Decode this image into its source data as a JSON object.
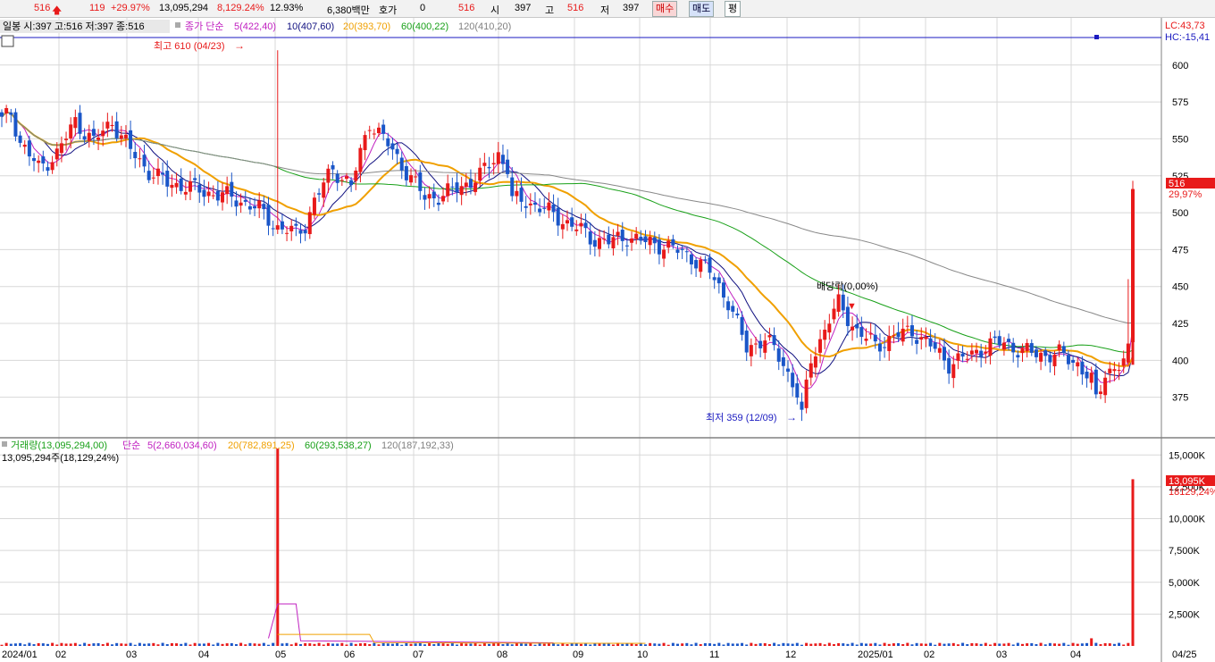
{
  "topbar": {
    "price": "516",
    "change": "119",
    "change_pct": "+29.97%",
    "volume": "13,095,294",
    "volume_ratio": "8,129.24%",
    "turnover_rate": "12.93%",
    "trade_value": "6,380백만",
    "quote_label": "호가",
    "quote_value": "0",
    "quote_price": "516",
    "open_label": "시",
    "open_value": "397",
    "high_label": "고",
    "high_value": "516",
    "low_label": "저",
    "low_value": "397",
    "buy_label": "매수",
    "sell_label": "매도",
    "avg_label": "평"
  },
  "price_legend": {
    "ohlc": "일봉 시:397 고:516 저:397 종:516",
    "ma_prefix": "종가 단순",
    "ma5": "5(422,40)",
    "ma10": "10(407,60)",
    "ma20": "20(393,70)",
    "ma60": "60(400,22)",
    "ma120": "120(410,20)"
  },
  "volume_legend": {
    "vol": "거래량(13,095,294,00)",
    "ma_prefix": "단순",
    "ma5": "5(2,660,034,60)",
    "ma20": "20(782,891,25)",
    "ma60": "60(293,538,27)",
    "ma120": "120(187,192,33)",
    "sub": "13,095,294주(18,129,24%)"
  },
  "right_labels": {
    "lc": "LC:43,73",
    "hc": "HC:-15,41",
    "last_price": "516",
    "last_pct": "29,97%",
    "last_vol": "13,095K",
    "last_vol_pct": "18129,24%"
  },
  "annotations": {
    "high": "최고 610 (04/23)",
    "low": "최저 359 (12/09)",
    "dividend": "배당락(0,00%)"
  },
  "colors": {
    "up": "#e81a1a",
    "down": "#1a56c8",
    "ma5": "#c020c0",
    "ma10": "#101080",
    "ma20": "#f0a000",
    "ma60": "#18a018",
    "ma120": "#888888",
    "grid": "#d8d8d8"
  },
  "chart_data": [
    {
      "type": "candlestick",
      "title": "",
      "x": [
        "2024/01",
        "02",
        "03",
        "04",
        "05",
        "06",
        "07",
        "08",
        "09",
        "10",
        "11",
        "12",
        "2025/01",
        "02",
        "03",
        "04",
        "04/25"
      ],
      "ylim": [
        350,
        615
      ],
      "y_ticks": [
        375,
        400,
        425,
        450,
        475,
        500,
        525,
        550,
        575,
        600
      ],
      "anchors": [
        [
          0,
          562
        ],
        [
          2,
          568
        ],
        [
          4,
          548
        ],
        [
          8,
          530
        ],
        [
          12,
          540
        ],
        [
          16,
          562
        ],
        [
          20,
          548
        ],
        [
          24,
          562
        ],
        [
          28,
          542
        ],
        [
          32,
          528
        ],
        [
          36,
          520
        ],
        [
          40,
          518
        ],
        [
          44,
          514
        ],
        [
          48,
          512
        ],
        [
          52,
          508
        ],
        [
          56,
          502
        ],
        [
          60,
          490
        ],
        [
          64,
          486
        ],
        [
          66,
          492
        ],
        [
          68,
          508
        ],
        [
          72,
          530
        ],
        [
          76,
          518
        ],
        [
          78,
          540
        ],
        [
          80,
          562
        ],
        [
          84,
          546
        ],
        [
          88,
          528
        ],
        [
          92,
          510
        ],
        [
          96,
          512
        ],
        [
          100,
          518
        ],
        [
          104,
          525
        ],
        [
          108,
          540
        ],
        [
          110,
          530
        ],
        [
          111,
          508
        ],
        [
          114,
          508
        ],
        [
          118,
          502
        ],
        [
          122,
          495
        ],
        [
          126,
          488
        ],
        [
          128,
          483
        ],
        [
          132,
          480
        ],
        [
          136,
          484
        ],
        [
          140,
          480
        ],
        [
          144,
          478
        ],
        [
          150,
          470
        ],
        [
          154,
          460
        ],
        [
          158,
          440
        ],
        [
          162,
          408
        ],
        [
          166,
          415
        ],
        [
          170,
          398
        ],
        [
          173,
          378
        ],
        [
          174,
          362
        ],
        [
          176,
          400
        ],
        [
          180,
          428
        ],
        [
          182,
          438
        ],
        [
          186,
          420
        ],
        [
          190,
          410
        ],
        [
          194,
          416
        ],
        [
          198,
          420
        ],
        [
          202,
          410
        ],
        [
          206,
          398
        ],
        [
          210,
          402
        ],
        [
          214,
          410
        ],
        [
          218,
          412
        ],
        [
          222,
          406
        ],
        [
          226,
          404
        ],
        [
          230,
          404
        ],
        [
          234,
          398
        ],
        [
          237,
          386
        ],
        [
          238,
          372
        ],
        [
          240,
          392
        ],
        [
          244,
          398
        ],
        [
          245,
          405
        ],
        [
          246,
          516
        ]
      ],
      "annotated_points": [
        {
          "label": "최고",
          "date": "04/23",
          "value": 610
        },
        {
          "label": "최저",
          "date": "12/09",
          "value": 359
        },
        {
          "label": "last",
          "date": "04/25",
          "open": 397,
          "high": 516,
          "low": 397,
          "close": 516
        }
      ],
      "moving_averages": [
        "MA5",
        "MA10",
        "MA20",
        "MA60",
        "MA120"
      ]
    },
    {
      "type": "bar",
      "title": "",
      "series_name": "거래량",
      "ylim": [
        0,
        16000
      ],
      "y_ticks": [
        "2,500K",
        "5,000K",
        "7,500K",
        "10,000K",
        "12,500K",
        "15,000K"
      ],
      "spikes": [
        {
          "date": "04/23",
          "value_k": 15500
        },
        {
          "date": "04/18",
          "value_k": 600
        },
        {
          "date": "04/25",
          "value_k": 13095
        }
      ],
      "baseline_k": 150
    }
  ]
}
